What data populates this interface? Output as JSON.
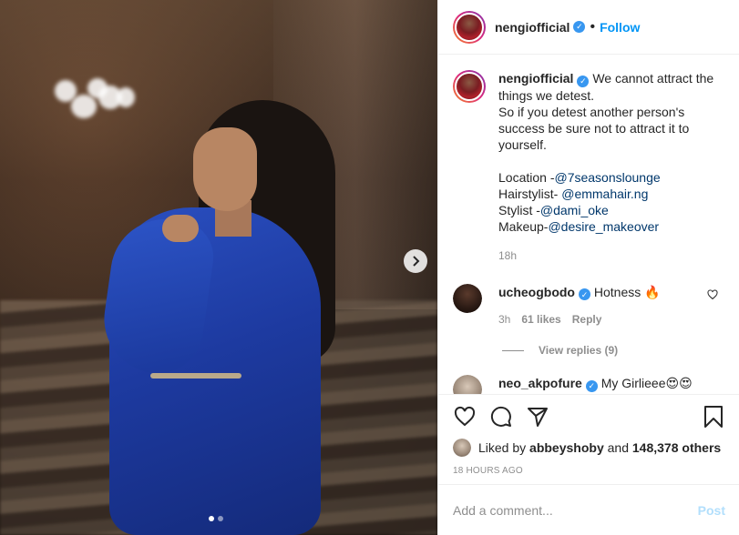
{
  "post": {
    "author": "nengiofficial",
    "follow_separator": "•",
    "follow_label": "Follow",
    "caption_lines": [
      "We cannot attract the",
      "things we detest.",
      "So if you detest another person's",
      "success be sure not to attract it to",
      "yourself."
    ],
    "credits": [
      {
        "label": "Location -",
        "mention": "@7seasonslounge"
      },
      {
        "label": "Hairstylist- ",
        "mention": "@emmahair.ng"
      },
      {
        "label": "Stylist -",
        "mention": "@dami_oke"
      },
      {
        "label": "Makeup-",
        "mention": "@desire_makeover"
      }
    ],
    "caption_time": "18h",
    "date": "18 HOURS AGO"
  },
  "comments": [
    {
      "user": "ucheogbodo",
      "text": "Hotness 🔥",
      "time": "3h",
      "likes": "61 likes",
      "reply": "Reply",
      "view_replies": "View replies (9)"
    },
    {
      "user": "neo_akpofure",
      "text": "My Girlieee😍😍"
    }
  ],
  "likes": {
    "prefix": "Liked by",
    "user": "abbeyshoby",
    "conjunction": "and",
    "others": "148,378 others"
  },
  "composer": {
    "placeholder": "Add a comment...",
    "post_label": "Post"
  },
  "carousel": {
    "current": 1,
    "total": 2
  },
  "icons": {
    "verified": "verified-badge-icon",
    "next": "chevron-right-icon",
    "like": "heart-icon",
    "comment": "comment-bubble-icon",
    "share": "paper-plane-icon",
    "save": "bookmark-icon",
    "comment_like": "small-heart-icon"
  },
  "colors": {
    "link": "#0095f6",
    "mention": "#00376b",
    "muted": "#8e8e8e",
    "verified": "#3897f0",
    "post_disabled": "#b2dffc"
  }
}
